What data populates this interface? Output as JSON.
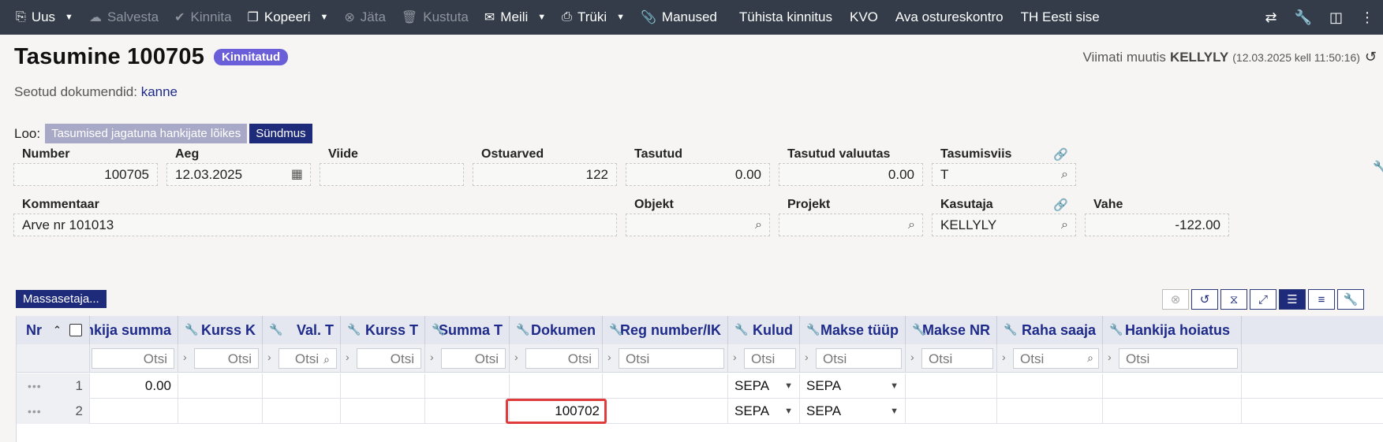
{
  "toolbar": {
    "items": [
      {
        "label": "Uus",
        "icon": "new-doc-icon",
        "caret": true,
        "disabled": false
      },
      {
        "label": "Salvesta",
        "icon": "cloud-upload-icon",
        "caret": false,
        "disabled": true
      },
      {
        "label": "Kinnita",
        "icon": "check-icon",
        "caret": false,
        "disabled": true
      },
      {
        "label": "Kopeeri",
        "icon": "copy-icon",
        "caret": true,
        "disabled": false
      },
      {
        "label": "Jäta",
        "icon": "cancel-circle-icon",
        "caret": false,
        "disabled": true
      },
      {
        "label": "Kustuta",
        "icon": "trash-icon",
        "caret": false,
        "disabled": true
      },
      {
        "label": "Meili",
        "icon": "mail-icon",
        "caret": true,
        "disabled": false
      },
      {
        "label": "Trüki",
        "icon": "printer-icon",
        "caret": true,
        "disabled": false
      },
      {
        "label": "Manused",
        "icon": "paperclip-icon",
        "caret": false,
        "disabled": false
      },
      {
        "label": "Tühista kinnitus",
        "icon": "",
        "caret": false,
        "disabled": false
      },
      {
        "label": "KVO",
        "icon": "",
        "caret": false,
        "disabled": false
      },
      {
        "label": "Ava ostureskontro",
        "icon": "",
        "caret": false,
        "disabled": false
      },
      {
        "label": "TH Eesti sise",
        "icon": "",
        "caret": false,
        "disabled": false
      }
    ]
  },
  "header": {
    "title": "Tasumine 100705",
    "status": "Kinnitatud",
    "last_modified_prefix": "Viimati muutis",
    "last_modified_user": "KELLYLY",
    "last_modified_time": "(12.03.2025 kell 11:50:16)"
  },
  "related": {
    "label": "Seotud dokumendid:",
    "link": "kanne"
  },
  "create": {
    "label": "Loo:",
    "btn1": "Tasumised jagatuna hankijate lõikes",
    "btn2": "Sündmus"
  },
  "fields": {
    "number": {
      "label": "Number",
      "value": "100705"
    },
    "aeg": {
      "label": "Aeg",
      "value": "12.03.2025"
    },
    "viide": {
      "label": "Viide",
      "value": ""
    },
    "ostuarved": {
      "label": "Ostuarved",
      "value": "122"
    },
    "tasutud": {
      "label": "Tasutud",
      "value": "0.00"
    },
    "tasutud_valuutas": {
      "label": "Tasutud valuutas",
      "value": "0.00"
    },
    "tasumisviis": {
      "label": "Tasumisviis",
      "value": "T"
    },
    "kommentaar": {
      "label": "Kommentaar",
      "value": "Arve nr 101013"
    },
    "objekt": {
      "label": "Objekt",
      "value": ""
    },
    "projekt": {
      "label": "Projekt",
      "value": ""
    },
    "kasutaja": {
      "label": "Kasutaja",
      "value": "KELLYLY"
    },
    "vahe": {
      "label": "Vahe",
      "value": "-122.00"
    }
  },
  "mass_button": "Massasetaja...",
  "grid": {
    "nr_header": "Nr",
    "columns": [
      "nkija summa",
      "Kurss K",
      "Val. T",
      "Kurss T",
      "Summa T",
      "Dokumen",
      "Reg number/IK",
      "Kulud",
      "Makse tüüp",
      "Makse NR",
      "Raha saaja",
      "Hankija hoiatus"
    ],
    "filter_placeholder": "Otsi",
    "rows": [
      {
        "nr": "1",
        "cells": [
          "0.00",
          "",
          "",
          "",
          "",
          "",
          "",
          "SEPA",
          "SEPA",
          "",
          "",
          ""
        ]
      },
      {
        "nr": "2",
        "cells": [
          "",
          "",
          "",
          "",
          "",
          "100702",
          "",
          "SEPA",
          "SEPA",
          "",
          "",
          ""
        ]
      }
    ]
  },
  "colors": {
    "toolbar": "#333c48",
    "badge": "#6a5fd8",
    "navy": "#1e2b7a",
    "highlight": "#e23b3b"
  }
}
